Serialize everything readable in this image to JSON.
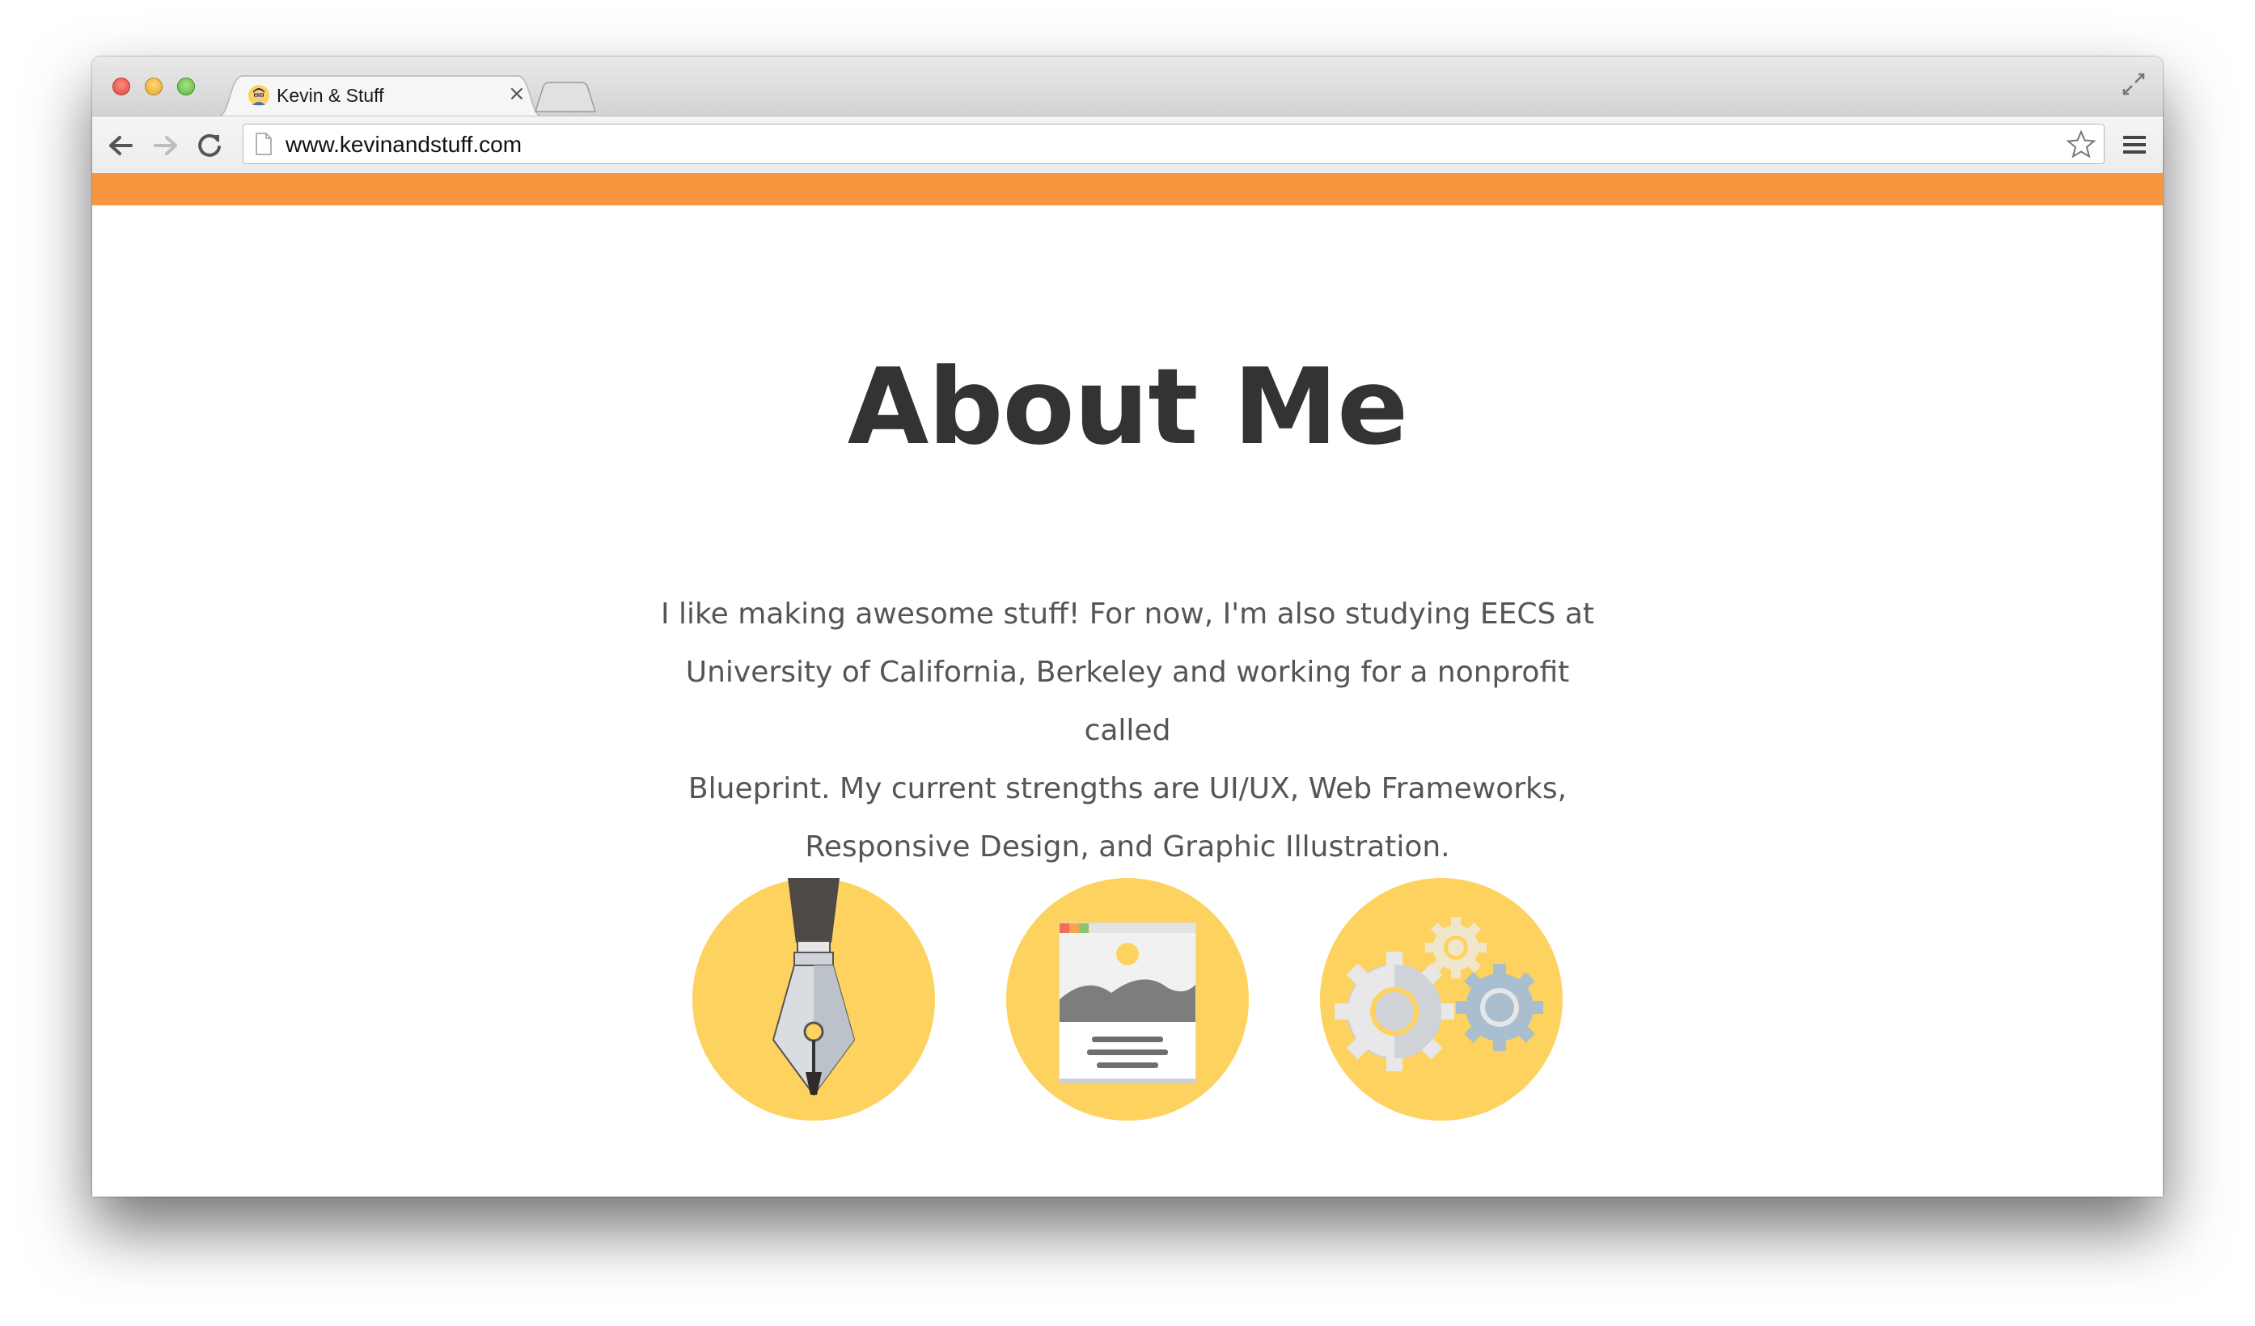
{
  "browser": {
    "tab": {
      "title": "Kevin & Stuff",
      "close_label": "×",
      "favicon": "avatar-favicon-icon"
    },
    "url": "www.kevinandstuff.com",
    "icons": {
      "back": "back-arrow-icon",
      "forward": "forward-arrow-icon",
      "reload": "reload-icon",
      "bookmark": "star-icon",
      "menu": "hamburger-menu-icon",
      "fullscreen": "fullscreen-icon"
    }
  },
  "page": {
    "accent_bar_color": "#f89640",
    "title": "About Me",
    "about_lines": [
      "I like making awesome stuff! For now, I'm also studying EECS at",
      "University of California, Berkeley and working for a nonprofit called",
      "Blueprint. My current strengths are UI/UX, Web Frameworks,",
      "Responsive Design, and Graphic Illustration."
    ],
    "skill_icons": [
      {
        "name": "pen-nib-icon"
      },
      {
        "name": "web-page-icon"
      },
      {
        "name": "gears-icon"
      }
    ],
    "skill_circle_color": "#fdd25f"
  }
}
